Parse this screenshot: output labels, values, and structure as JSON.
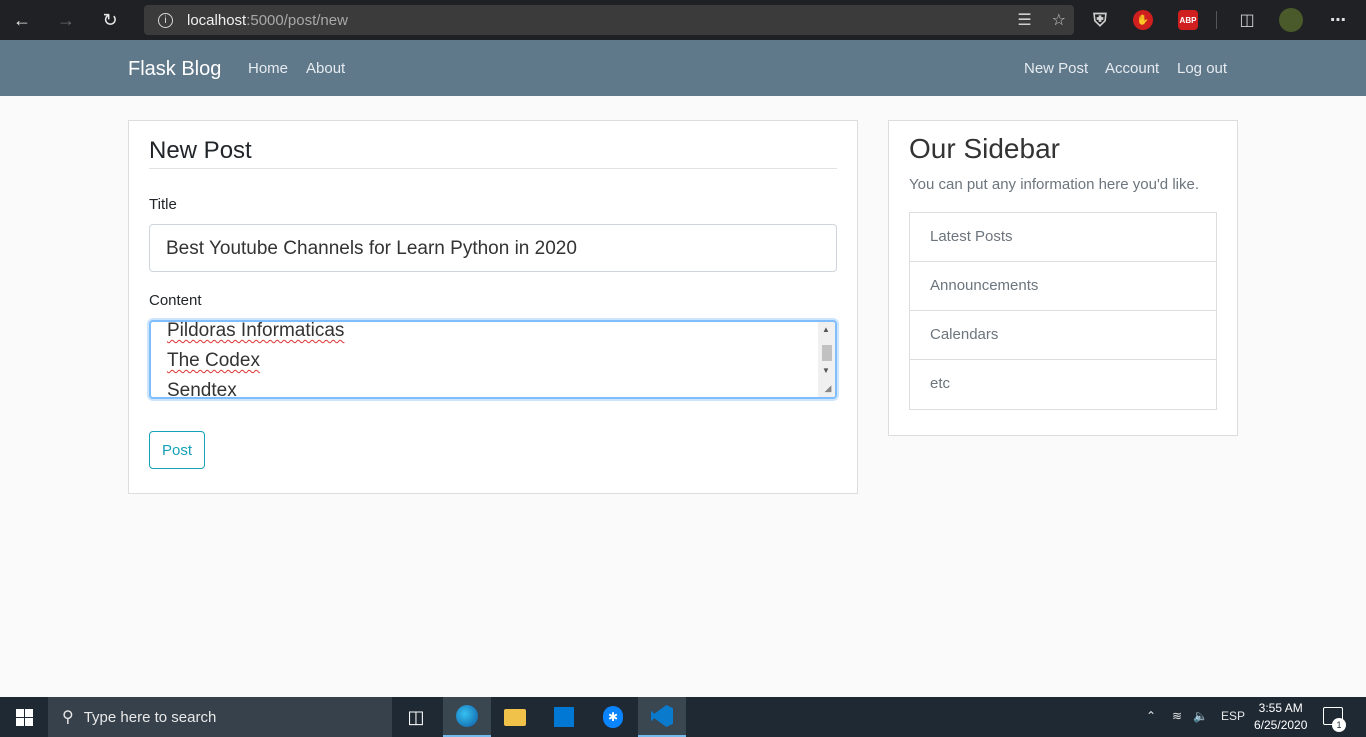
{
  "browser": {
    "url_host": "localhost",
    "url_path": ":5000/post/new"
  },
  "navbar": {
    "brand": "Flask Blog",
    "left_links": [
      "Home",
      "About"
    ],
    "right_links": [
      "New Post",
      "Account",
      "Log out"
    ]
  },
  "form": {
    "legend": "New Post",
    "title_label": "Title",
    "title_value": "Best Youtube Channels for Learn Python in 2020",
    "content_label": "Content",
    "content_lines": [
      "Pildoras Informaticas",
      "The Codex",
      "Sendtex"
    ],
    "submit_label": "Post"
  },
  "sidebar": {
    "title": "Our Sidebar",
    "text": "You can put any information here you'd like.",
    "items": [
      "Latest Posts",
      "Announcements",
      "Calendars",
      "etc"
    ]
  },
  "taskbar": {
    "search_placeholder": "Type here to search",
    "language": "ESP",
    "time": "3:55 AM",
    "date": "6/25/2020",
    "notification_count": "1"
  }
}
